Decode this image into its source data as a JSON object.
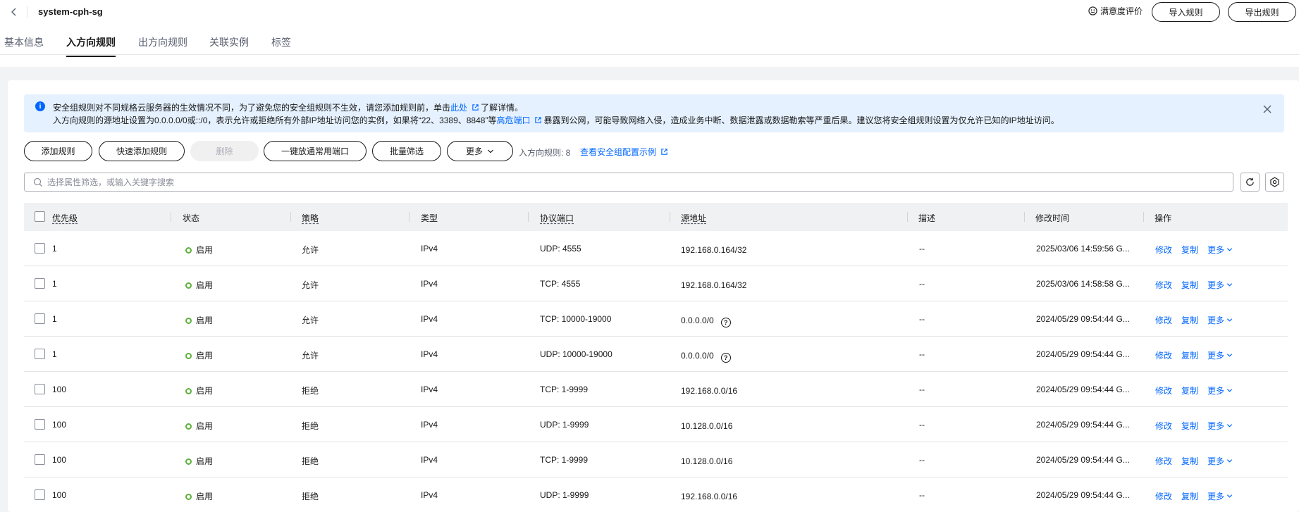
{
  "header": {
    "title": "system-cph-sg",
    "satisfaction": "满意度评价",
    "import_btn": "导入规则",
    "export_btn": "导出规则"
  },
  "tabs": [
    {
      "label": "基本信息",
      "active": false
    },
    {
      "label": "入方向规则",
      "active": true
    },
    {
      "label": "出方向规则",
      "active": false
    },
    {
      "label": "关联实例",
      "active": false
    },
    {
      "label": "标签",
      "active": false
    }
  ],
  "alert": {
    "line1_pre": "安全组规则对不同规格云服务器的生效情况不同，为了避免您的安全组规则不生效，请您添加规则前，单击",
    "line1_link": "此处",
    "line1_post": "了解详情。",
    "line2_pre": "入方向规则的源地址设置为0.0.0.0/0或::/0，表示允许或拒绝所有外部IP地址访问您的实例，如果将“22、3389、8848”等",
    "line2_link": "高危端口",
    "line2_post": "暴露到公网，可能导致网络入侵，造成业务中断、数据泄露或数据勒索等严重后果。建议您将安全组规则设置为仅允许已知的IP地址访问。"
  },
  "toolbar": {
    "add_rule": "添加规则",
    "quick_add": "快速添加规则",
    "delete": "删除",
    "open_ports": "一键放通常用端口",
    "batch_filter": "批量筛选",
    "more": "更多",
    "rule_count": "入方向规则: 8",
    "example_link": "查看安全组配置示例"
  },
  "search": {
    "placeholder": "选择属性筛选，或输入关键字搜索"
  },
  "columns": {
    "priority": "优先级",
    "status": "状态",
    "policy": "策略",
    "type": "类型",
    "port": "协议端口",
    "source": "源地址",
    "desc": "描述",
    "modified": "修改时间",
    "ops": "操作"
  },
  "ops": {
    "edit": "修改",
    "copy": "复制",
    "more": "更多"
  },
  "rows": [
    {
      "priority": "1",
      "status": "启用",
      "policy": "允许",
      "type": "IPv4",
      "port": "UDP: 4555",
      "source": "192.168.0.164/32",
      "help": false,
      "desc": "--",
      "modified": "2025/03/06 14:59:56 G..."
    },
    {
      "priority": "1",
      "status": "启用",
      "policy": "允许",
      "type": "IPv4",
      "port": "TCP: 4555",
      "source": "192.168.0.164/32",
      "help": false,
      "desc": "--",
      "modified": "2025/03/06 14:58:58 G..."
    },
    {
      "priority": "1",
      "status": "启用",
      "policy": "允许",
      "type": "IPv4",
      "port": "TCP: 10000-19000",
      "source": "0.0.0.0/0",
      "help": true,
      "desc": "--",
      "modified": "2024/05/29 09:54:44 G..."
    },
    {
      "priority": "1",
      "status": "启用",
      "policy": "允许",
      "type": "IPv4",
      "port": "UDP: 10000-19000",
      "source": "0.0.0.0/0",
      "help": true,
      "desc": "--",
      "modified": "2024/05/29 09:54:44 G..."
    },
    {
      "priority": "100",
      "status": "启用",
      "policy": "拒绝",
      "type": "IPv4",
      "port": "TCP: 1-9999",
      "source": "192.168.0.0/16",
      "help": false,
      "desc": "--",
      "modified": "2024/05/29 09:54:44 G..."
    },
    {
      "priority": "100",
      "status": "启用",
      "policy": "拒绝",
      "type": "IPv4",
      "port": "UDP: 1-9999",
      "source": "10.128.0.0/16",
      "help": false,
      "desc": "--",
      "modified": "2024/05/29 09:54:44 G..."
    },
    {
      "priority": "100",
      "status": "启用",
      "policy": "拒绝",
      "type": "IPv4",
      "port": "TCP: 1-9999",
      "source": "10.128.0.0/16",
      "help": false,
      "desc": "--",
      "modified": "2024/05/29 09:54:44 G..."
    },
    {
      "priority": "100",
      "status": "启用",
      "policy": "拒绝",
      "type": "IPv4",
      "port": "UDP: 1-9999",
      "source": "192.168.0.0/16",
      "help": false,
      "desc": "--",
      "modified": "2024/05/29 09:54:44 G..."
    }
  ],
  "colors": {
    "link": "#0066ff",
    "status_enabled": "#5db13a",
    "alert_bg": "#e5f1ff"
  },
  "icons": [
    "chevron-left-icon",
    "smile-icon",
    "info-icon",
    "external-link-icon",
    "close-icon",
    "chevron-down-icon",
    "search-icon",
    "refresh-icon",
    "gear-icon",
    "question-icon"
  ]
}
